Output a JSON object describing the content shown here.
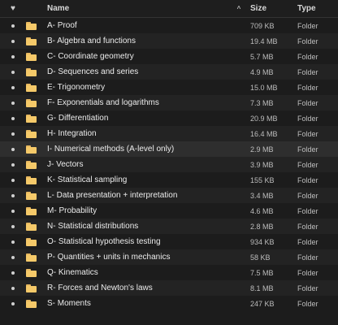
{
  "header": {
    "favorite_icon": "heart-icon",
    "name_label": "Name",
    "sort_indicator": "^",
    "size_label": "Size",
    "type_label": "Type"
  },
  "rows": [
    {
      "name": "A- Proof",
      "size": "709 KB",
      "type": "Folder"
    },
    {
      "name": "B- Algebra and functions",
      "size": "19.4 MB",
      "type": "Folder"
    },
    {
      "name": "C- Coordinate geometry",
      "size": "5.7 MB",
      "type": "Folder"
    },
    {
      "name": "D- Sequences and series",
      "size": "4.9 MB",
      "type": "Folder"
    },
    {
      "name": "E- Trigonometry",
      "size": "15.0 MB",
      "type": "Folder"
    },
    {
      "name": "F- Exponentials and logarithms",
      "size": "7.3 MB",
      "type": "Folder"
    },
    {
      "name": "G- Differentiation",
      "size": "20.9 MB",
      "type": "Folder"
    },
    {
      "name": "H- Integration",
      "size": "16.4 MB",
      "type": "Folder"
    },
    {
      "name": "I- Numerical methods (A-level only)",
      "size": "2.9 MB",
      "type": "Folder"
    },
    {
      "name": "J- Vectors",
      "size": "3.9 MB",
      "type": "Folder"
    },
    {
      "name": "K- Statistical sampling",
      "size": "155 KB",
      "type": "Folder"
    },
    {
      "name": "L- Data presentation + interpretation",
      "size": "3.4 MB",
      "type": "Folder"
    },
    {
      "name": "M- Probability",
      "size": "4.6 MB",
      "type": "Folder"
    },
    {
      "name": "N- Statistical distributions",
      "size": "2.8 MB",
      "type": "Folder"
    },
    {
      "name": "O- Statistical hypothesis testing",
      "size": "934 KB",
      "type": "Folder"
    },
    {
      "name": "P- Quantities + units in mechanics",
      "size": "58 KB",
      "type": "Folder"
    },
    {
      "name": "Q- Kinematics",
      "size": "7.5 MB",
      "type": "Folder"
    },
    {
      "name": "R- Forces and Newton's laws",
      "size": "8.1 MB",
      "type": "Folder"
    },
    {
      "name": "S- Moments",
      "size": "247 KB",
      "type": "Folder"
    }
  ]
}
